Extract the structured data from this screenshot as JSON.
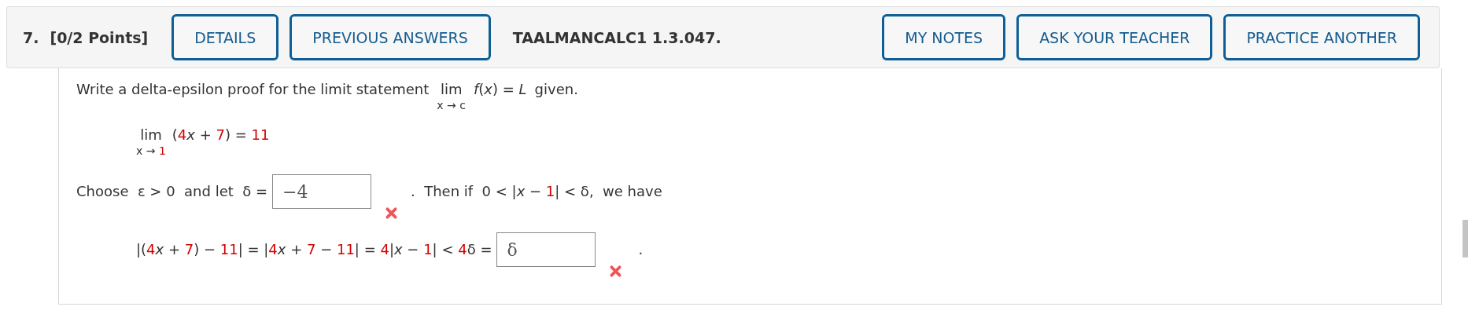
{
  "question": {
    "number": "7.",
    "points": "[0/2 Points]"
  },
  "left_buttons": [
    {
      "label": "DETAILS"
    },
    {
      "label": "PREVIOUS ANSWERS"
    }
  ],
  "source": "TAALMANCALC1 1.3.047.",
  "right_buttons": [
    {
      "label": "MY NOTES"
    },
    {
      "label": "ASK YOUR TEACHER"
    },
    {
      "label": "PRACTICE ANOTHER"
    }
  ],
  "prompt": {
    "text": "Write a delta-epsilon proof for the limit statement",
    "lim": "lim",
    "sub": [
      {
        "t": "x → c",
        "highlight": false
      }
    ],
    "expr": [
      {
        "t": "*f*(*x*) = *L*",
        "highlight": false
      }
    ],
    "after": "given."
  },
  "limit": {
    "lim": "lim",
    "sub": [
      {
        "t": "x →",
        "highlight": false
      },
      {
        "t": " 1",
        "highlight": true
      }
    ],
    "expr": [
      {
        "t": "(",
        "highlight": false
      },
      {
        "t": "4",
        "highlight": true
      },
      {
        "t": "*x* + ",
        "highlight": false
      },
      {
        "t": "7",
        "highlight": true
      },
      {
        "t": ") = ",
        "highlight": false
      },
      {
        "t": "11",
        "highlight": true
      }
    ]
  },
  "choose": {
    "before": [
      {
        "t": "Choose  ε > 0  and let  δ =",
        "highlight": false
      }
    ],
    "answer": {
      "value": "−4",
      "correct": false
    },
    "after": [
      {
        "t": ".  Then if  0 < |*x* − ",
        "highlight": false
      },
      {
        "t": "1",
        "highlight": true
      },
      {
        "t": "| < δ,  we have",
        "highlight": false
      }
    ]
  },
  "chain": {
    "before": [
      {
        "t": "|(",
        "highlight": false
      },
      {
        "t": "4",
        "highlight": true
      },
      {
        "t": "*x* + ",
        "highlight": false
      },
      {
        "t": "7",
        "highlight": true
      },
      {
        "t": ") − ",
        "highlight": false
      },
      {
        "t": "11",
        "highlight": true
      },
      {
        "t": "| = |",
        "highlight": false
      },
      {
        "t": "4",
        "highlight": true
      },
      {
        "t": "*x* + ",
        "highlight": false
      },
      {
        "t": "7",
        "highlight": true
      },
      {
        "t": " − ",
        "highlight": false
      },
      {
        "t": "11",
        "highlight": true
      },
      {
        "t": "| = ",
        "highlight": false
      },
      {
        "t": "4",
        "highlight": true
      },
      {
        "t": "|*x* − ",
        "highlight": false
      },
      {
        "t": "1",
        "highlight": true
      },
      {
        "t": "| < ",
        "highlight": false
      },
      {
        "t": "4",
        "highlight": true
      },
      {
        "t": "δ =",
        "highlight": false
      }
    ],
    "answer": {
      "value": "δ",
      "correct": false
    },
    "after": "."
  }
}
